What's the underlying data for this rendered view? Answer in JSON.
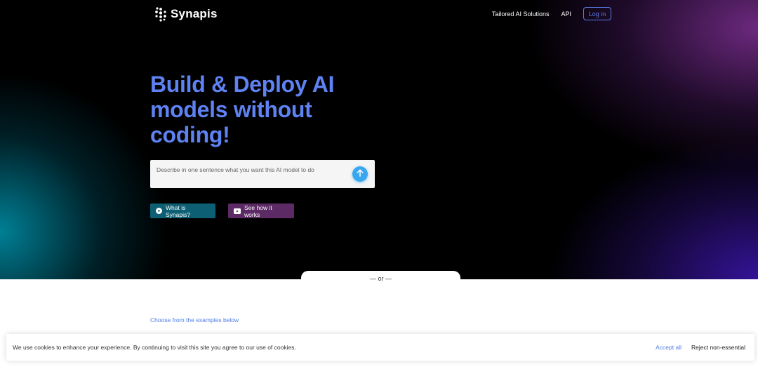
{
  "header": {
    "logo_text": "Synapis",
    "nav": [
      {
        "label": "Tailored AI Solutions"
      },
      {
        "label": "API"
      }
    ],
    "login_label": "Log in"
  },
  "hero": {
    "headline": "Build & Deploy AI models without coding!",
    "prompt_placeholder": "Describe in one sentence what you want this AI model to do",
    "buttons": {
      "what_is": "What is Synapis?",
      "see_how": "See how it works"
    }
  },
  "divider": {
    "label": "— or —"
  },
  "examples": {
    "link_label": "Choose from the examples below"
  },
  "cookie_banner": {
    "message": "We use cookies to enhance your experience. By continuing to visit this site you agree to our use of cookies.",
    "accept_label": "Accept all",
    "reject_label": "Reject non-essential"
  },
  "colors": {
    "accent_blue": "#5e82f2",
    "send_button": "#3aa6ee",
    "pill_teal": "#0d5f73",
    "pill_purple": "#5c2a64"
  },
  "icons": {
    "logo": "synapis-logo-icon",
    "send": "arrow-up-icon",
    "play": "play-circle-icon",
    "video": "video-play-icon"
  }
}
